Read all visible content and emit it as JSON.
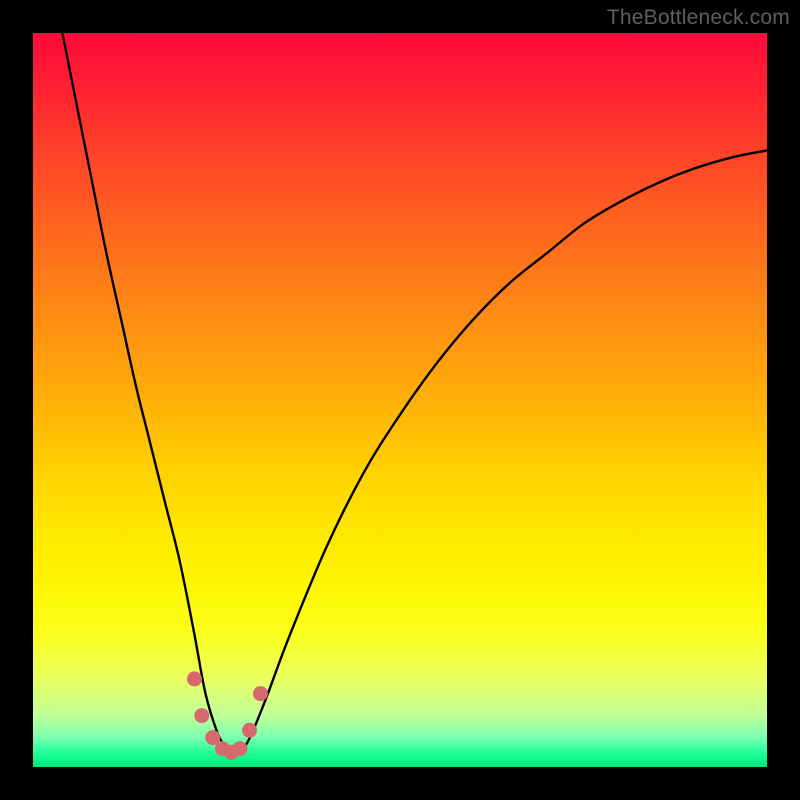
{
  "watermark": "TheBottleneck.com",
  "chart_data": {
    "type": "line",
    "title": "",
    "xlabel": "",
    "ylabel": "",
    "xlim": [
      0,
      100
    ],
    "ylim": [
      0,
      100
    ],
    "series": [
      {
        "name": "bottleneck-curve",
        "x": [
          4,
          6,
          8,
          10,
          12,
          14,
          16,
          18,
          20,
          22,
          23.5,
          25,
          26,
          27,
          28,
          29,
          30,
          32,
          35,
          40,
          45,
          50,
          55,
          60,
          65,
          70,
          75,
          80,
          85,
          90,
          95,
          100
        ],
        "values": [
          100,
          90,
          80,
          70,
          61,
          52,
          44,
          36,
          28,
          18,
          10,
          5,
          3,
          2,
          2,
          3,
          5,
          10,
          18,
          30,
          40,
          48,
          55,
          61,
          66,
          70,
          74,
          77,
          79.5,
          81.5,
          83,
          84
        ]
      }
    ],
    "markers": {
      "name": "emphasis-points",
      "color": "#d6696b",
      "x": [
        22.0,
        23.0,
        24.5,
        25.8,
        27.0,
        28.2,
        29.5,
        31.0
      ],
      "values": [
        12.0,
        7.0,
        4.0,
        2.5,
        2.0,
        2.5,
        5.0,
        10.0
      ]
    },
    "gradient_stops": [
      {
        "pos": 0.0,
        "color": "#ff0a3a"
      },
      {
        "pos": 0.4,
        "color": "#ff8a14"
      },
      {
        "pos": 0.7,
        "color": "#ffe800"
      },
      {
        "pos": 0.95,
        "color": "#7affb0"
      },
      {
        "pos": 1.0,
        "color": "#00e878"
      }
    ]
  }
}
